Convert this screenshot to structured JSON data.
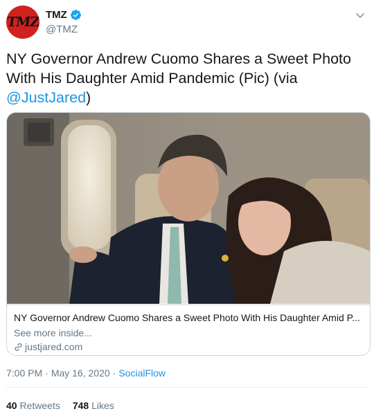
{
  "author": {
    "avatar_text": "TMZ",
    "display_name": "TMZ",
    "handle": "@TMZ",
    "verified": true
  },
  "tweet": {
    "text_line1": "NY Governor Andrew Cuomo Shares a Sweet Photo",
    "text_line2": "With His Daughter Amid Pandemic (Pic) (via",
    "mention": "@JustJared",
    "text_end": ")"
  },
  "card": {
    "title": "NY Governor Andrew Cuomo Shares a Sweet Photo With His Daughter Amid P...",
    "description": "See more inside...",
    "domain": "justjared.com"
  },
  "meta": {
    "time": "7:00 PM",
    "date": "May 16, 2020",
    "source": "SocialFlow"
  },
  "stats": {
    "retweets_count": "40",
    "retweets_label": "Retweets",
    "likes_count": "748",
    "likes_label": "Likes"
  },
  "colors": {
    "link_blue": "#1b95e0",
    "secondary_gray": "#657786",
    "avatar_red": "#d0211c",
    "border": "#ccd6dd"
  },
  "icons": [
    "verified-badge-icon",
    "chevron-down-icon",
    "link-icon"
  ]
}
